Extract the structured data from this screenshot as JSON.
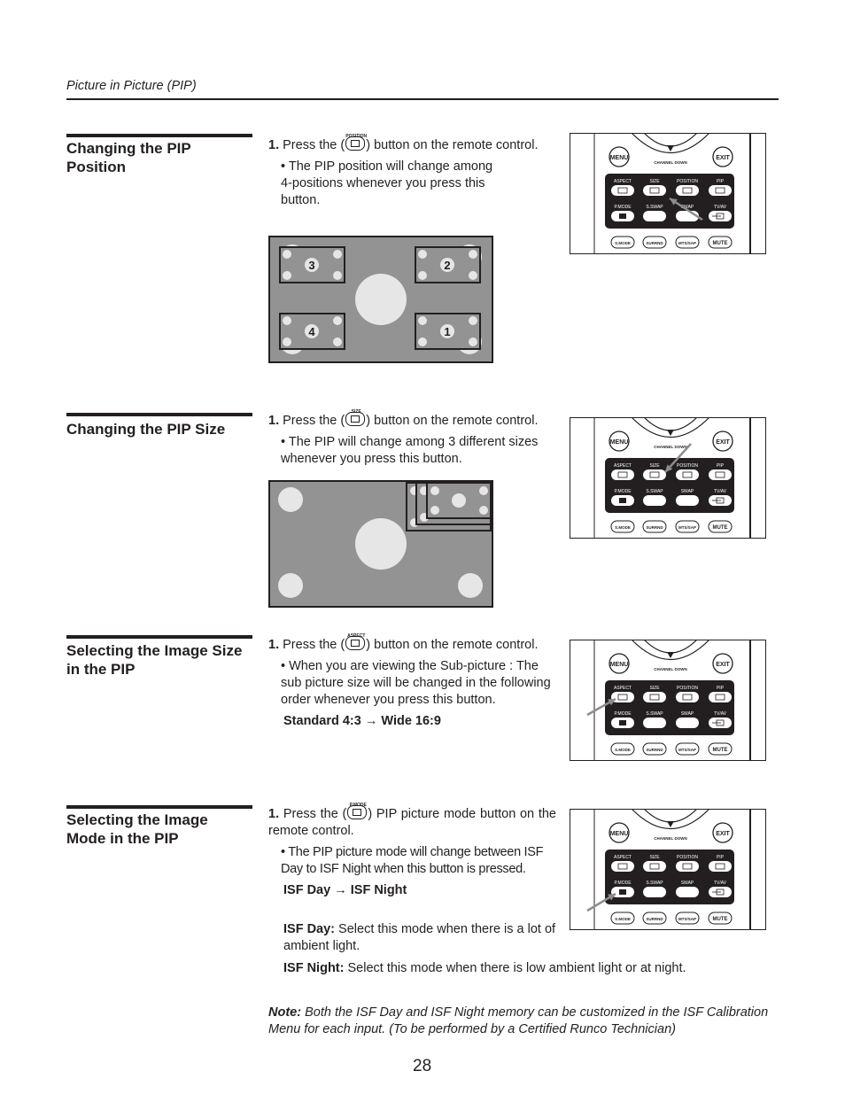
{
  "header": {
    "title": "Picture in Picture (PIP)"
  },
  "sections": [
    {
      "title": "Changing the PIP Position",
      "step_number": "1.",
      "step_pre": "Press the (",
      "step_icon": {
        "name": "position-button-icon",
        "label": "POSITION"
      },
      "step_post": ") button on the remote control.",
      "bullet": "• The PIP position will change among 4-positions whenever you press this button.",
      "diagram": {
        "type": "pip-positions",
        "labels": [
          "3",
          "2",
          "4",
          "1"
        ]
      },
      "remote_highlight": "POSITION"
    },
    {
      "title": "Changing the PIP Size",
      "step_number": "1.",
      "step_pre": "Press the (",
      "step_icon": {
        "name": "size-button-icon",
        "label": "SIZE"
      },
      "step_post": ") button on the remote control.",
      "bullet": "• The PIP will change among 3 different sizes whenever you press this button.",
      "diagram": {
        "type": "pip-sizes",
        "sizes_count": 3
      },
      "remote_highlight": "SIZE"
    },
    {
      "title": "Selecting the Image Size in the PIP",
      "step_number": "1.",
      "step_pre": "Press the (",
      "step_icon": {
        "name": "aspect-button-icon",
        "label": "ASPECT"
      },
      "step_post": ") button on the remote control.",
      "bullet": "• When you are viewing the Sub-picture : The sub picture size will be changed in the following order whenever you press this button.",
      "sequence": "Standard 4:3 → Wide 16:9",
      "remote_highlight": "ASPECT"
    },
    {
      "title": "Selecting the Image Mode in the PIP",
      "step_number": "1.",
      "step_pre": "Press the (",
      "step_icon": {
        "name": "pmode-button-icon",
        "label": "P.MODE"
      },
      "step_post": ") PIP picture mode button on the remote control.",
      "bullet": "• The PIP picture mode will change between ISF Day to ISF Night when this button is pressed.",
      "sequence": "ISF Day → ISF Night",
      "defs": [
        {
          "term": "ISF Day:",
          "text": " Select this mode when there is a lot of ambient light."
        },
        {
          "term": "ISF Night:",
          "text": " Select this mode when there is low ambient light or at night."
        }
      ],
      "remote_highlight": "P.MODE"
    }
  ],
  "remote": {
    "menu": "MENU",
    "exit": "EXIT",
    "channel_down": "CHANNEL DOWN",
    "row1": [
      "ASPECT",
      "SIZE",
      "POSITION",
      "PIP"
    ],
    "row2": [
      "P.MODE",
      "S.SWAP",
      "SWAP",
      "TV/AV"
    ],
    "row3": [
      "S.MODE",
      "SURRND",
      "MTS/SAP",
      "MUTE"
    ]
  },
  "note": {
    "label": "Note:",
    "text": " Both the ISF Day and ISF Night memory can be customized in the ISF Calibration Menu for each input. (To be performed by a Certified Runco Technician)"
  },
  "page_number": "28",
  "colors": {
    "screen_gray": "#939393",
    "circle_light": "#e6e6e6",
    "ink": "#231f20",
    "arrow_gray": "#8c8c8c"
  }
}
